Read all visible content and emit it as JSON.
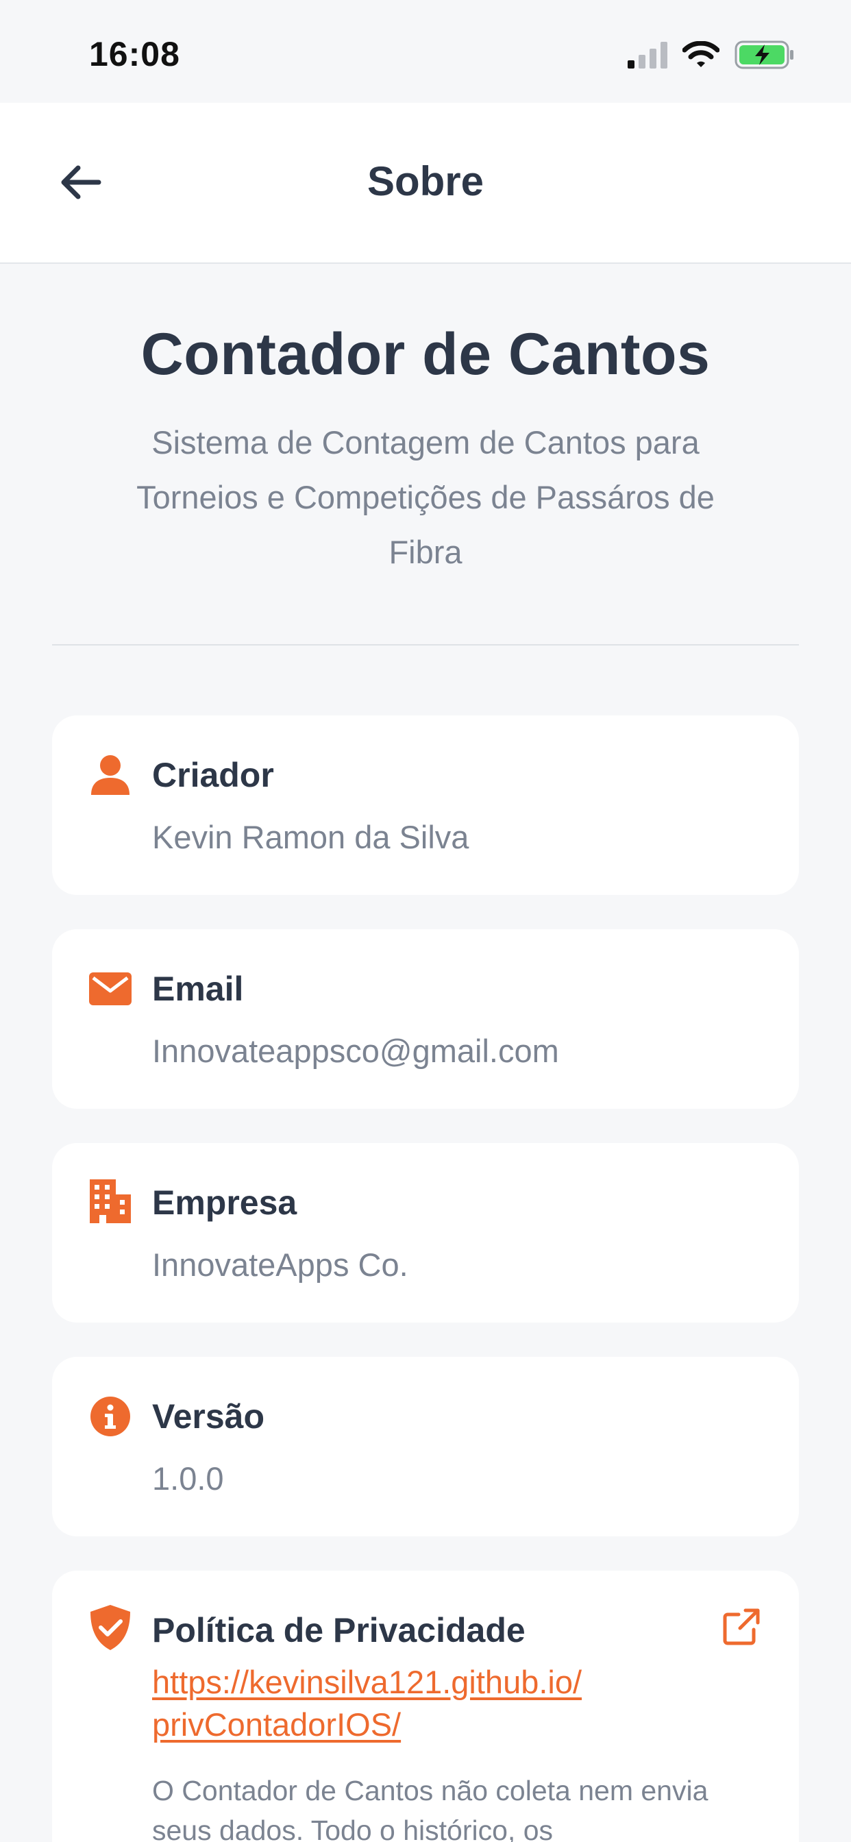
{
  "status_bar": {
    "time": "16:08",
    "icons": [
      "cellular-signal-icon",
      "wifi-icon",
      "battery-charging-icon"
    ]
  },
  "nav": {
    "title": "Sobre",
    "back_icon": "arrow-left-icon"
  },
  "header": {
    "title": "Contador de Cantos",
    "subtitle": "Sistema de Contagem  de Cantos para\nTorneios e Competições de Passáros de\nFibra"
  },
  "cards": {
    "creator": {
      "icon": "person-icon",
      "label": "Criador",
      "value": "Kevin Ramon da Silva"
    },
    "email": {
      "icon": "envelope-icon",
      "label": "Email",
      "value": "Innovateappsco@gmail.com"
    },
    "company": {
      "icon": "building-icon",
      "label": "Empresa",
      "value": "InnovateApps Co."
    },
    "version": {
      "icon": "info-icon",
      "label": "Versão",
      "value": "1.0.0"
    },
    "privacy": {
      "icon": "shield-check-icon",
      "label": "Política de Privacidade",
      "link": "https://kevinsilva121.github.io/\nprivContadorIOS/",
      "description": "O Contador de Cantos não coleta nem envia seus dados. Todo o histórico, os",
      "external_icon": "external-link-icon"
    }
  },
  "colors": {
    "accent": "#ee6a2e",
    "text_dark": "#2d3748",
    "text_muted": "#7b8391",
    "background": "#f6f7f9",
    "card": "#ffffff",
    "battery": "#4cd964"
  }
}
